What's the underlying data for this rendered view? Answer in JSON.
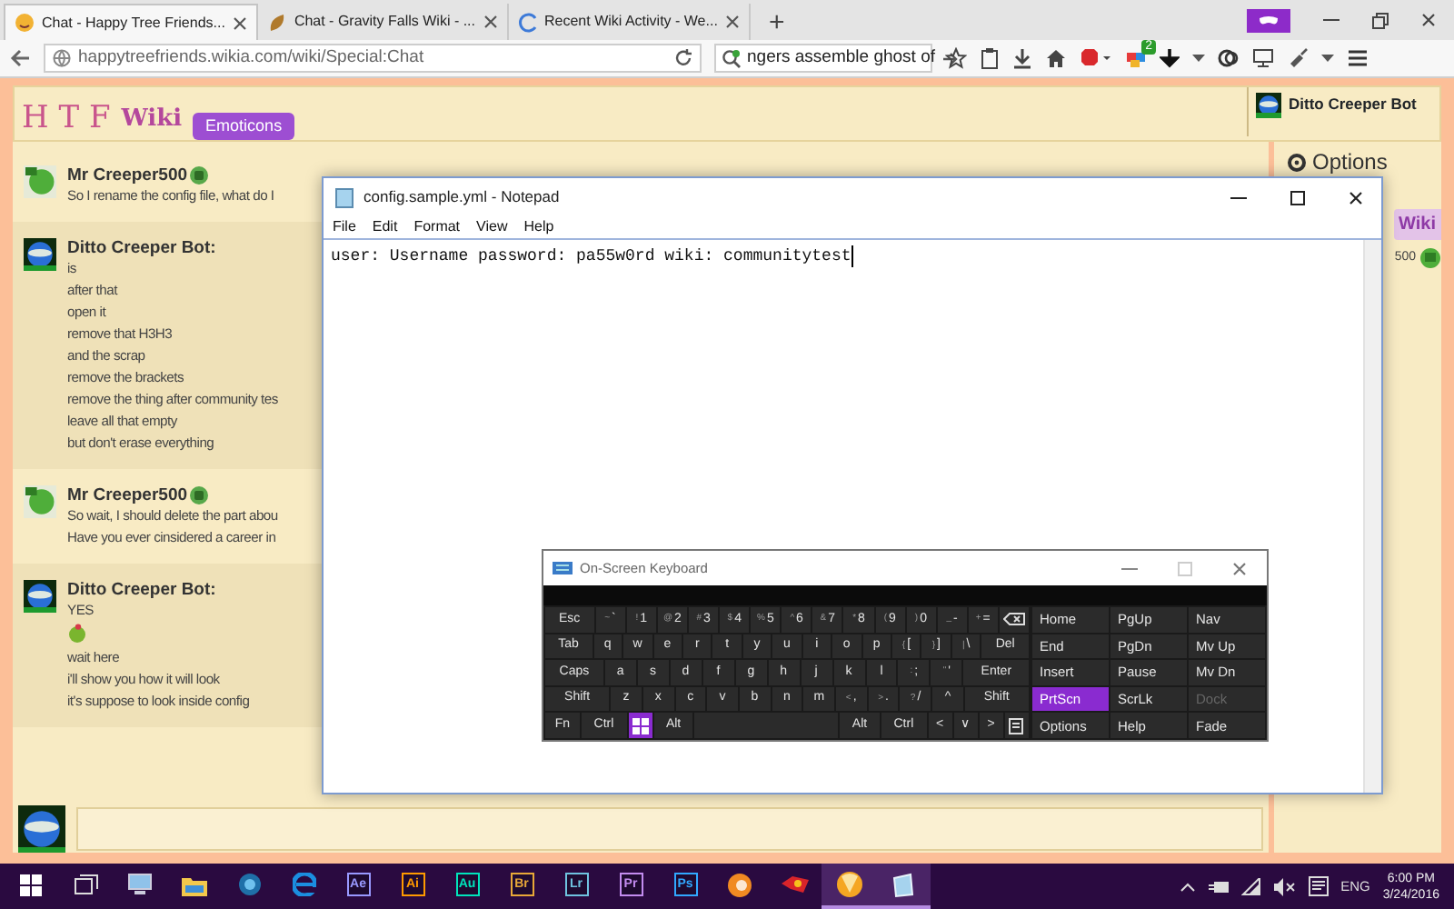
{
  "browser": {
    "tabs": [
      {
        "title": "Chat - Happy Tree Friends...",
        "selected": true
      },
      {
        "title": "Chat - Gravity Falls Wiki - ...",
        "selected": false
      },
      {
        "title": "Recent Wiki Activity - We...",
        "selected": false
      }
    ],
    "new_tab": "+",
    "url": "happytreefriends.wikia.com/wiki/Special:Chat",
    "search": "ngers assemble ghost of",
    "extension_badge": "2"
  },
  "chat": {
    "logo_letters": "H T F",
    "logo_wiki": "Wiki",
    "emoticons_button": "Emoticons",
    "current_user": "Ditto Creeper Bot",
    "options": "Options",
    "side_wiki": "Wiki",
    "side_user": "500",
    "messages": [
      {
        "user": "Mr Creeper500",
        "kind": "human",
        "lines": [
          {
            "kind": "text",
            "text": "So I rename the config file, what do I"
          }
        ]
      },
      {
        "user": "Ditto Creeper Bot:",
        "kind": "bot",
        "lines": [
          {
            "kind": "text",
            "text": "is"
          },
          {
            "kind": "text",
            "text": "after that"
          },
          {
            "kind": "text",
            "text": "open it"
          },
          {
            "kind": "text",
            "text": "remove that H3H3"
          },
          {
            "kind": "text",
            "text": "and the scrap"
          },
          {
            "kind": "text",
            "text": "remove the brackets"
          },
          {
            "kind": "text",
            "text": "remove the thing after community tes"
          },
          {
            "kind": "text",
            "text": "leave all that empty"
          },
          {
            "kind": "text",
            "text": "but don't erase everything"
          }
        ]
      },
      {
        "user": "Mr Creeper500",
        "kind": "human",
        "lines": [
          {
            "kind": "text",
            "text": "So wait, I should delete the part abou"
          },
          {
            "kind": "text",
            "text": "Have you ever cinsidered a career in"
          }
        ]
      },
      {
        "user": "Ditto Creeper Bot:",
        "kind": "bot",
        "lines": [
          {
            "kind": "text",
            "text": "YES"
          },
          {
            "kind": "emoji"
          },
          {
            "kind": "text",
            "text": "wait here"
          },
          {
            "kind": "text",
            "text": "i'll show you how it will look"
          },
          {
            "kind": "text",
            "text": "it's suppose to look inside config"
          }
        ]
      }
    ]
  },
  "notepad": {
    "title": "config.sample.yml - Notepad",
    "menu": [
      "File",
      "Edit",
      "Format",
      "View",
      "Help"
    ],
    "content": "user: Username password: pa55w0rd wiki: communitytest"
  },
  "keyboard": {
    "title": "On-Screen Keyboard",
    "rows": [
      {
        "keys": [
          {
            "label": "Esc",
            "pressed": false
          },
          {
            "label": "`",
            "shift": "~",
            "pressed": false
          },
          {
            "label": "1",
            "shift": "!",
            "pressed": false
          },
          {
            "label": "2",
            "shift": "@",
            "pressed": false
          },
          {
            "label": "3",
            "shift": "#",
            "pressed": false
          },
          {
            "label": "4",
            "shift": "$",
            "pressed": false
          },
          {
            "label": "5",
            "shift": "%",
            "pressed": false
          },
          {
            "label": "6",
            "shift": "^",
            "pressed": false
          },
          {
            "label": "7",
            "shift": "&",
            "pressed": false
          },
          {
            "label": "8",
            "shift": "*",
            "pressed": false
          },
          {
            "label": "9",
            "shift": "(",
            "pressed": false
          },
          {
            "label": "0",
            "shift": ")",
            "pressed": false
          },
          {
            "label": "-",
            "shift": "_",
            "pressed": false
          },
          {
            "label": "=",
            "shift": "+",
            "pressed": false
          },
          {
            "kind": "backspace",
            "pressed": false
          }
        ]
      },
      {
        "keys": [
          {
            "label": "Tab",
            "pressed": false
          },
          {
            "label": "q",
            "pressed": false
          },
          {
            "label": "w",
            "pressed": false
          },
          {
            "label": "e",
            "pressed": false
          },
          {
            "label": "r",
            "pressed": false
          },
          {
            "label": "t",
            "pressed": false
          },
          {
            "label": "y",
            "pressed": false
          },
          {
            "label": "u",
            "pressed": false
          },
          {
            "label": "i",
            "pressed": false
          },
          {
            "label": "o",
            "pressed": false
          },
          {
            "label": "p",
            "pressed": false
          },
          {
            "label": "[",
            "shift": "{",
            "pressed": false
          },
          {
            "label": "]",
            "shift": "}",
            "pressed": false
          },
          {
            "label": "\\",
            "shift": "|",
            "pressed": false
          },
          {
            "label": "Del",
            "pressed": false
          }
        ]
      },
      {
        "keys": [
          {
            "label": "Caps",
            "pressed": false
          },
          {
            "label": "a",
            "pressed": false
          },
          {
            "label": "s",
            "pressed": false
          },
          {
            "label": "d",
            "pressed": false
          },
          {
            "label": "f",
            "pressed": false
          },
          {
            "label": "g",
            "pressed": false
          },
          {
            "label": "h",
            "pressed": false
          },
          {
            "label": "j",
            "pressed": false
          },
          {
            "label": "k",
            "pressed": false
          },
          {
            "label": "l",
            "pressed": false
          },
          {
            "label": ";",
            "shift": ":",
            "pressed": false
          },
          {
            "label": "'",
            "shift": "\"",
            "pressed": false
          },
          {
            "label": "Enter",
            "pressed": false
          }
        ]
      },
      {
        "keys": [
          {
            "label": "Shift",
            "pressed": false
          },
          {
            "label": "z",
            "pressed": false
          },
          {
            "label": "x",
            "pressed": false
          },
          {
            "label": "c",
            "pressed": false
          },
          {
            "label": "v",
            "pressed": false
          },
          {
            "label": "b",
            "pressed": false
          },
          {
            "label": "n",
            "pressed": false
          },
          {
            "label": "m",
            "pressed": false
          },
          {
            "label": ",",
            "shift": "<",
            "pressed": false
          },
          {
            "label": ".",
            "shift": ">",
            "pressed": false
          },
          {
            "label": "/",
            "shift": "?",
            "pressed": false
          },
          {
            "label": "^",
            "pressed": false
          },
          {
            "label": "Shift",
            "pressed": false
          }
        ]
      },
      {
        "keys": [
          {
            "label": "Fn",
            "pressed": false
          },
          {
            "label": "Ctrl",
            "pressed": false
          },
          {
            "kind": "windows",
            "pressed": true
          },
          {
            "label": "Alt",
            "pressed": false
          },
          {
            "kind": "space",
            "pressed": false
          },
          {
            "label": "Alt",
            "pressed": false
          },
          {
            "label": "Ctrl",
            "pressed": false
          },
          {
            "label": "<",
            "pressed": false
          },
          {
            "label": "∨",
            "pressed": false
          },
          {
            "label": ">",
            "pressed": false
          },
          {
            "kind": "menu",
            "pressed": false
          }
        ]
      }
    ],
    "nav": [
      [
        {
          "label": "Home",
          "pressed": false,
          "disabled": false
        },
        {
          "label": "PgUp",
          "pressed": false,
          "disabled": false
        },
        {
          "label": "Nav",
          "pressed": false,
          "disabled": false
        }
      ],
      [
        {
          "label": "End",
          "pressed": false,
          "disabled": false
        },
        {
          "label": "PgDn",
          "pressed": false,
          "disabled": false
        },
        {
          "label": "Mv Up",
          "pressed": false,
          "disabled": false
        }
      ],
      [
        {
          "label": "Insert",
          "pressed": false,
          "disabled": false
        },
        {
          "label": "Pause",
          "pressed": false,
          "disabled": false
        },
        {
          "label": "Mv Dn",
          "pressed": false,
          "disabled": false
        }
      ],
      [
        {
          "label": "PrtScn",
          "pressed": true,
          "disabled": false
        },
        {
          "label": "ScrLk",
          "pressed": false,
          "disabled": false
        },
        {
          "label": "Dock",
          "pressed": false,
          "disabled": true
        }
      ],
      [
        {
          "label": "Options",
          "pressed": false,
          "disabled": false
        },
        {
          "label": "Help",
          "pressed": false,
          "disabled": false
        },
        {
          "label": "Fade",
          "pressed": false,
          "disabled": false
        }
      ]
    ]
  },
  "taskbar": {
    "apps": [
      {
        "kind": "start",
        "active": false
      },
      {
        "kind": "task-view",
        "active": false
      },
      {
        "kind": "computer",
        "active": false
      },
      {
        "kind": "folder",
        "active": false
      },
      {
        "kind": "disc",
        "active": false
      },
      {
        "kind": "browser-e",
        "active": false
      },
      {
        "kind": "letters",
        "label": "Ae",
        "color": "#9999ff",
        "active": false
      },
      {
        "kind": "letters",
        "label": "Ai",
        "color": "#ff9a00",
        "active": false
      },
      {
        "kind": "letters",
        "label": "Au",
        "color": "#00e4bb",
        "active": false
      },
      {
        "kind": "letters",
        "label": "Br",
        "color": "#e8a838",
        "active": false
      },
      {
        "kind": "letters",
        "label": "Lr",
        "color": "#6fc3e0",
        "active": false
      },
      {
        "kind": "letters",
        "label": "Pr",
        "color": "#c38cf0",
        "active": false
      },
      {
        "kind": "letters",
        "label": "Ps",
        "color": "#31a8ff",
        "active": false
      },
      {
        "kind": "orange-ball",
        "active": false
      },
      {
        "kind": "red-app",
        "active": false
      },
      {
        "kind": "fox",
        "active": true
      },
      {
        "kind": "notepad",
        "active": true
      }
    ],
    "language": "ENG",
    "time": "6:00 PM",
    "date": "3/24/2016"
  }
}
